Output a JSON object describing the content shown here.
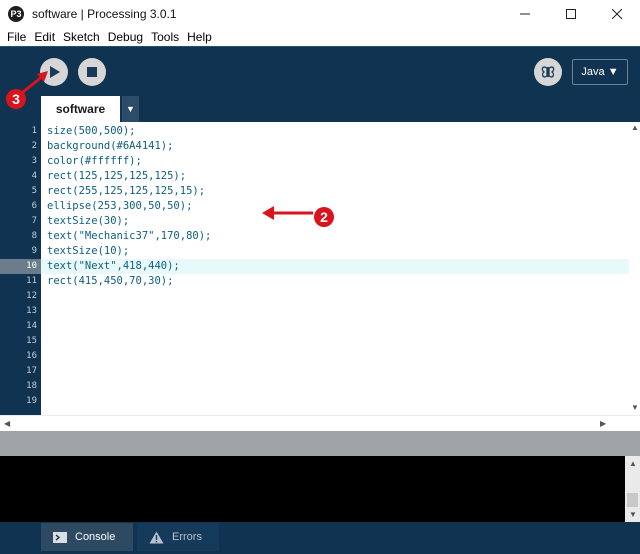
{
  "window": {
    "logo_glyph": "P3",
    "title": "software | Processing 3.0.1"
  },
  "menu": [
    "File",
    "Edit",
    "Sketch",
    "Debug",
    "Tools",
    "Help"
  ],
  "toolbar": {
    "mode_label": "Java ▼"
  },
  "annotations": {
    "run_marker": "3",
    "code_marker": "2",
    "color": "#d9141c"
  },
  "tabs": {
    "active": "software",
    "menu_arrow": "▼"
  },
  "editor": {
    "line_numbers": [
      "1",
      "2",
      "3",
      "4",
      "5",
      "6",
      "7",
      "8",
      "9",
      "10",
      "11",
      "12",
      "13",
      "14",
      "15",
      "16",
      "17",
      "18",
      "19"
    ],
    "current_line": 10,
    "lines": [
      "size(500,500);",
      "background(#6A4141);",
      "color(#ffffff);",
      "rect(125,125,125,125);",
      "rect(255,125,125,125,15);",
      "ellipse(253,300,50,50);",
      "textSize(30);",
      "text(\"Mechanic37\",170,80);",
      "textSize(10);",
      "text(\"Next\",418,440);",
      "rect(415,450,70,30);"
    ]
  },
  "footer": {
    "console_label": "Console",
    "errors_label": "Errors"
  },
  "colors": {
    "chrome": "#0f3350",
    "code_text": "#0e5e80",
    "current_line": "#e8f9fb"
  }
}
